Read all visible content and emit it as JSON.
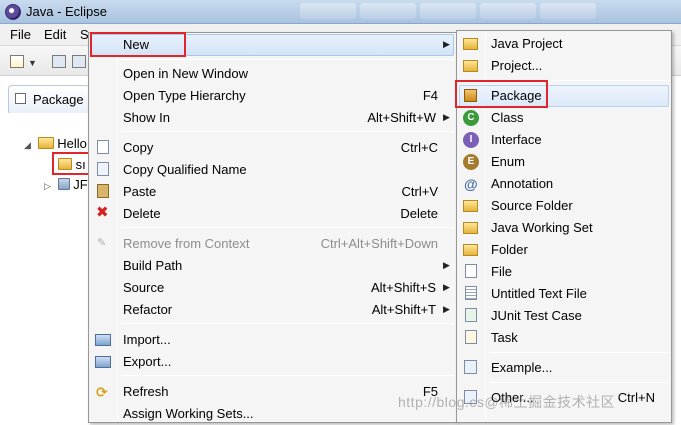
{
  "window": {
    "title": "Java - Eclipse"
  },
  "menubar": [
    "File",
    "Edit",
    "S"
  ],
  "explorer": {
    "tab_label": "Package E",
    "tree": [
      {
        "label": "Hello",
        "twisty": "◢"
      },
      {
        "label": "sı",
        "twisty": ""
      },
      {
        "label": "JF",
        "twisty": "▷"
      }
    ]
  },
  "context_menu": {
    "items": [
      {
        "label": "New",
        "accel": "",
        "submenu": true,
        "highlighted": true
      },
      {
        "label": "Open in New Window",
        "accel": ""
      },
      {
        "label": "Open Type Hierarchy",
        "accel": "F4"
      },
      {
        "label": "Show In",
        "accel": "Alt+Shift+W",
        "submenu": true
      },
      {
        "label": "Copy",
        "accel": "Ctrl+C",
        "icon": "copy-icon"
      },
      {
        "label": "Copy Qualified Name",
        "accel": "",
        "icon": "copy-qualified-icon"
      },
      {
        "label": "Paste",
        "accel": "Ctrl+V",
        "icon": "paste-icon"
      },
      {
        "label": "Delete",
        "accel": "Delete",
        "icon": "delete-icon"
      },
      {
        "label": "Remove from Context",
        "accel": "Ctrl+Alt+Shift+Down",
        "disabled": true,
        "icon": "remove-context-icon"
      },
      {
        "label": "Build Path",
        "accel": "",
        "submenu": true
      },
      {
        "label": "Source",
        "accel": "Alt+Shift+S",
        "submenu": true
      },
      {
        "label": "Refactor",
        "accel": "Alt+Shift+T",
        "submenu": true
      },
      {
        "label": "Import...",
        "accel": "",
        "icon": "import-icon"
      },
      {
        "label": "Export...",
        "accel": "",
        "icon": "export-icon"
      },
      {
        "label": "Refresh",
        "accel": "F5",
        "icon": "refresh-icon"
      },
      {
        "label": "Assign Working Sets...",
        "accel": ""
      }
    ]
  },
  "new_submenu": {
    "items": [
      {
        "label": "Java Project",
        "icon": "java-project-icon"
      },
      {
        "label": "Project...",
        "icon": "project-icon"
      },
      {
        "label": "Package",
        "icon": "package-icon",
        "highlighted": true
      },
      {
        "label": "Class",
        "icon": "class-icon"
      },
      {
        "label": "Interface",
        "icon": "interface-icon"
      },
      {
        "label": "Enum",
        "icon": "enum-icon"
      },
      {
        "label": "Annotation",
        "icon": "annotation-icon"
      },
      {
        "label": "Source Folder",
        "icon": "source-folder-icon"
      },
      {
        "label": "Java Working Set",
        "icon": "working-set-icon"
      },
      {
        "label": "Folder",
        "icon": "folder-icon"
      },
      {
        "label": "File",
        "icon": "file-icon"
      },
      {
        "label": "Untitled Text File",
        "icon": "text-file-icon"
      },
      {
        "label": "JUnit Test Case",
        "icon": "junit-icon"
      },
      {
        "label": "Task",
        "icon": "task-icon"
      },
      {
        "label": "Example...",
        "icon": "example-icon"
      },
      {
        "label": "Other...",
        "accel": "Ctrl+N",
        "icon": "other-icon"
      }
    ]
  },
  "watermark": "http://blog.cs@稀土掘金技术社区",
  "colors": {
    "highlight_box": "#e0262b",
    "menu_bg": "#f5f5f5",
    "hover": "#d3e4f7"
  }
}
